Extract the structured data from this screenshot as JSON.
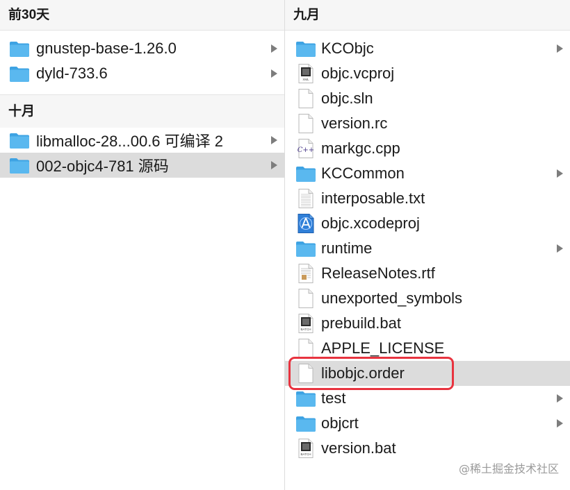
{
  "left_column": {
    "header": "前30天",
    "recent_items": [
      {
        "label": "gnustep-base-1.26.0",
        "type": "folder",
        "has_children": true,
        "selected": false
      },
      {
        "label": "dyld-733.6",
        "type": "folder",
        "has_children": true,
        "selected": false
      }
    ],
    "section_header": "十月",
    "october_items": [
      {
        "label": "libmalloc-28...00.6 可编译 2",
        "type": "folder",
        "has_children": true,
        "selected": false
      },
      {
        "label": "002-objc4-781 源码",
        "type": "folder",
        "has_children": true,
        "selected": true
      }
    ]
  },
  "right_column": {
    "header": "九月",
    "items": [
      {
        "label": "KCObjc",
        "type": "folder",
        "has_children": true
      },
      {
        "label": "objc.vcproj",
        "type": "xml",
        "icon_text": "XML",
        "has_children": false
      },
      {
        "label": "objc.sln",
        "type": "blank",
        "has_children": false
      },
      {
        "label": "version.rc",
        "type": "blank",
        "has_children": false
      },
      {
        "label": "markgc.cpp",
        "type": "cpp",
        "icon_text": "C++",
        "has_children": false
      },
      {
        "label": "KCCommon",
        "type": "folder",
        "has_children": true
      },
      {
        "label": "interposable.txt",
        "type": "text",
        "has_children": false
      },
      {
        "label": "objc.xcodeproj",
        "type": "xcode",
        "has_children": false
      },
      {
        "label": "runtime",
        "type": "folder",
        "has_children": true
      },
      {
        "label": "ReleaseNotes.rtf",
        "type": "rtf",
        "has_children": false
      },
      {
        "label": "unexported_symbols",
        "type": "blank",
        "has_children": false
      },
      {
        "label": "prebuild.bat",
        "type": "batch",
        "icon_text": "BATCH",
        "has_children": false
      },
      {
        "label": "APPLE_LICENSE",
        "type": "blank",
        "has_children": false
      },
      {
        "label": "libobjc.order",
        "type": "blank",
        "has_children": false,
        "selected": true,
        "highlighted": true
      },
      {
        "label": "test",
        "type": "folder",
        "has_children": true
      },
      {
        "label": "objcrt",
        "type": "folder",
        "has_children": true
      },
      {
        "label": "version.bat",
        "type": "batch",
        "icon_text": "BATCH",
        "has_children": false
      }
    ]
  },
  "watermark": "@稀土掘金技术社区",
  "colors": {
    "folder": "#5ab8ef",
    "selection": "#dcdcdc",
    "highlight_border": "#e8333f"
  }
}
